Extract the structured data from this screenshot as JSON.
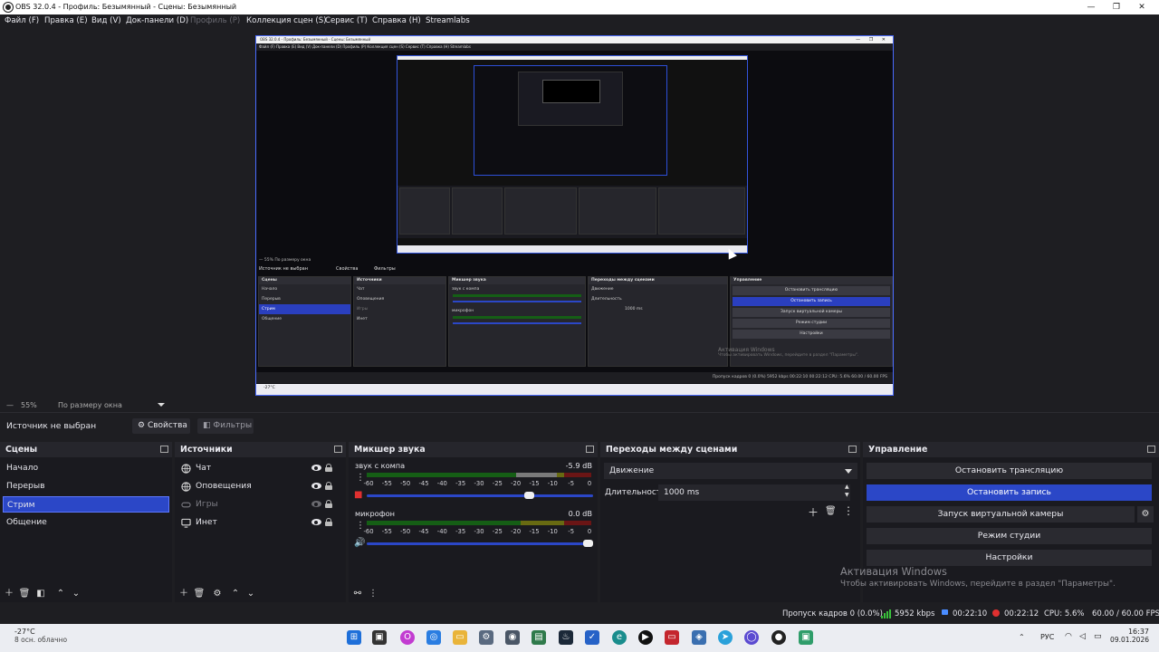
{
  "window": {
    "title": "OBS 32.0.4 - Профиль: Безымянный - Сцены: Безымянный",
    "minimize": "—",
    "maximize": "❐",
    "close": "✕"
  },
  "menu": [
    {
      "label": "Файл (F)",
      "disabled": false
    },
    {
      "label": "Правка (E)",
      "disabled": false
    },
    {
      "label": "Вид (V)",
      "disabled": false
    },
    {
      "label": "Док-панели (D)",
      "disabled": false
    },
    {
      "label": "Профиль (P)",
      "disabled": true
    },
    {
      "label": "Коллекция сцен (S)",
      "disabled": false
    },
    {
      "label": "Сервис (T)",
      "disabled": false
    },
    {
      "label": "Справка (H)",
      "disabled": false
    },
    {
      "label": "Streamlabs",
      "disabled": false
    }
  ],
  "preview": {
    "nested_title": "OBS 32.0.4 - Профиль: Безымянный - Сцены: Безымянный",
    "nested_menu": "Файл (F)   Правка (E)   Вид (V)   Док-панели (D)   Профиль (P)   Коллекция сцен (S)   Сервис (T)   Справка (H)   Streamlabs",
    "nested_zoom": "—   55%   По размеру окна",
    "nested_source": "Источник не выбран",
    "nested_props": "Свойства",
    "nested_filters": "Фильтры",
    "nested_docks": {
      "scenes": {
        "title": "Сцены",
        "items": [
          "Начало",
          "Перерыв",
          "Стрим",
          "Общение"
        ],
        "selected": 2
      },
      "sources": {
        "title": "Источники",
        "items": [
          "Чат",
          "Оповещения",
          "Игры",
          "Инет"
        ]
      },
      "mixer": {
        "title": "Микшер звука",
        "ch1": "звук с компа",
        "ch1_db": "-5.9 dB",
        "ch2": "микрофон",
        "ch2_db": "0.0 dB"
      },
      "transitions": {
        "title": "Переходы между сценами",
        "transition": "Движение",
        "duration_label": "Длительность",
        "duration": "1000 ms"
      },
      "controls": {
        "title": "Управление",
        "buttons": [
          "Остановить трансляцию",
          "Остановить запись",
          "Запуск виртуальной камеры",
          "Режим студии",
          "Настройки"
        ]
      }
    },
    "nested_activation": "Активация Windows",
    "nested_activation_sub": "Чтобы активировать Windows, перейдите в раздел \"Параметры\".",
    "nested_status": "Пропуск кадров 0 (0.0%)   5952 kbps   00:22:10   00:22:12   CPU: 5.6%   60.00 / 60.00 FPS",
    "nested_weather": "-27°C"
  },
  "zoombar": {
    "minus": "—",
    "zoom": "55%",
    "fit": "По размеру окна"
  },
  "source_toolbar": {
    "no_source": "Источник не выбран",
    "properties": "Свойства",
    "filters": "Фильтры"
  },
  "scenes": {
    "title": "Сцены",
    "items": [
      "Начало",
      "Перерыв",
      "Стрим",
      "Общение"
    ],
    "selected_index": 2
  },
  "sources": {
    "title": "Источники",
    "items": [
      {
        "label": "Чат",
        "icon": "globe-icon",
        "visible": true
      },
      {
        "label": "Оповещения",
        "icon": "globe-icon",
        "visible": true
      },
      {
        "label": "Игры",
        "icon": "gamepad-icon",
        "visible": false
      },
      {
        "label": "Инет",
        "icon": "monitor-icon",
        "visible": true
      }
    ]
  },
  "mixer": {
    "title": "Микшер звука",
    "ticks": [
      "-60",
      "-55",
      "-50",
      "-45",
      "-40",
      "-35",
      "-30",
      "-25",
      "-20",
      "-15",
      "-10",
      "-5",
      "0"
    ],
    "channels": [
      {
        "name": "звук с компа",
        "db": "-5.9 dB",
        "fader": 0.74,
        "muted": true
      },
      {
        "name": "микрофон",
        "db": "0.0 dB",
        "fader": 1.0,
        "muted": false
      }
    ]
  },
  "transitions": {
    "title": "Переходы между сценами",
    "transition": "Движение",
    "duration_label": "Длительность",
    "duration_value": "1000 ms"
  },
  "controls": {
    "title": "Управление",
    "stop_stream": "Остановить трансляцию",
    "stop_record": "Остановить запись",
    "virtual_cam": "Запуск виртуальной камеры",
    "studio_mode": "Режим студии",
    "settings": "Настройки"
  },
  "activation": {
    "title": "Активация Windows",
    "subtitle": "Чтобы активировать Windows, перейдите в раздел \"Параметры\"."
  },
  "status": {
    "dropped": "Пропуск кадров 0 (0.0%)",
    "bitrate": "5952 kbps",
    "stream_time": "00:22:10",
    "rec_time": "00:22:12",
    "cpu": "CPU: 5.6%",
    "fps": "60.00 / 60.00 FPS"
  },
  "taskbar": {
    "temp": "-27°C",
    "weather": "8 осн. облачно",
    "lang": "РУС",
    "time": "16:37",
    "date": "09.01.2026"
  },
  "colors": {
    "accent": "#2b47c7",
    "panel": "#1a1a1f",
    "header": "#26262c",
    "meter_green": "#155e15",
    "meter_yellow": "#686a12",
    "meter_red": "#6a1515"
  }
}
